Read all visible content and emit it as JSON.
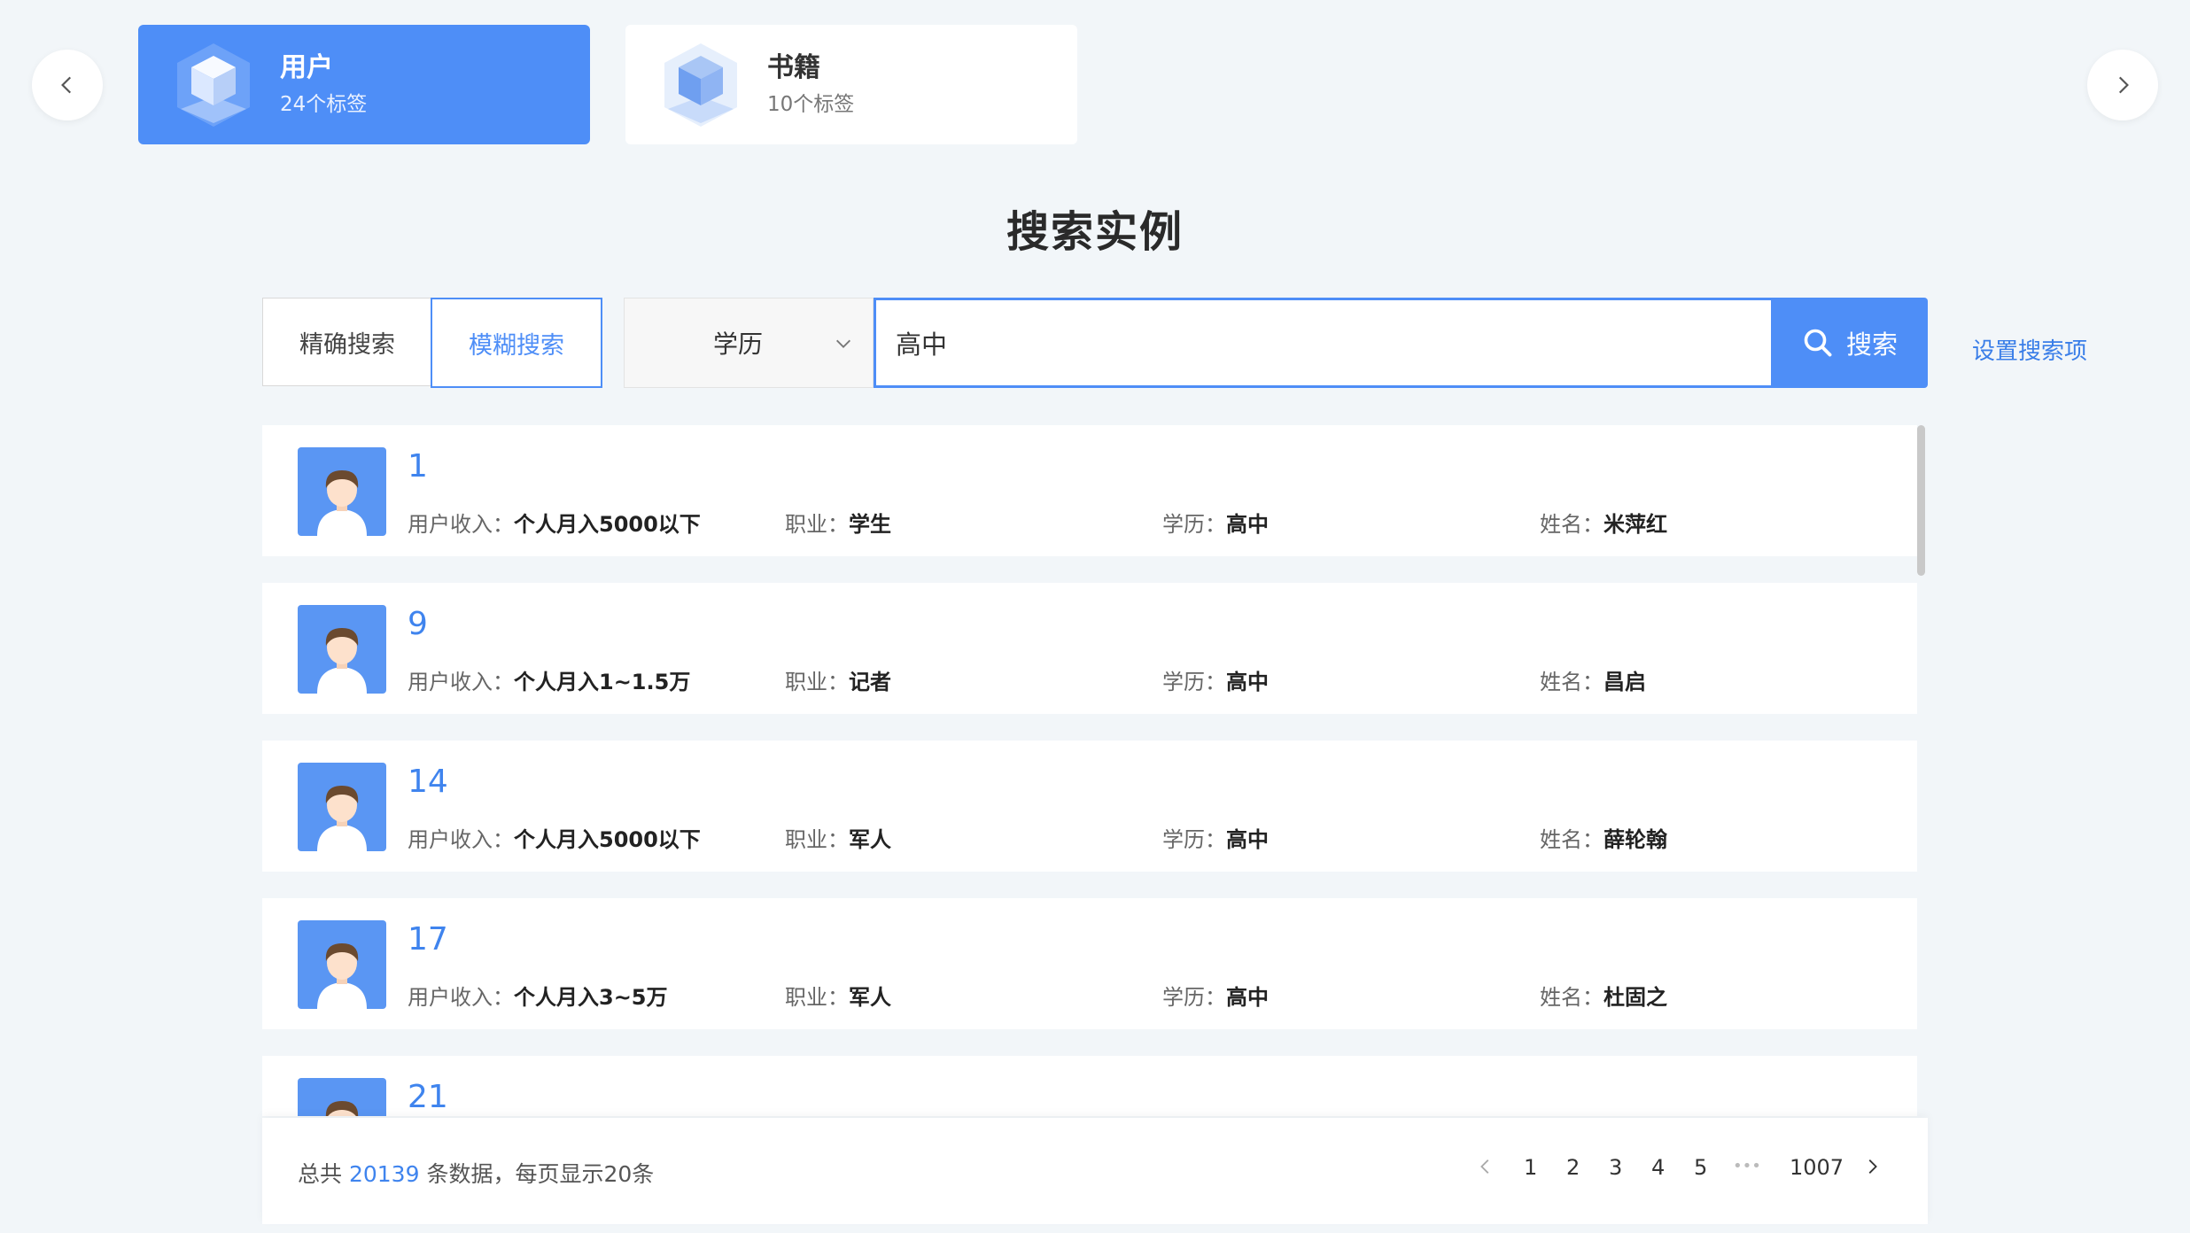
{
  "nav": {
    "prev_icon": "chevron-left-icon",
    "next_icon": "chevron-right-icon"
  },
  "cards": [
    {
      "title": "用户",
      "subtitle": "24个标签",
      "active": true,
      "icon": "cube-icon"
    },
    {
      "title": "书籍",
      "subtitle": "10个标签",
      "active": false,
      "icon": "cube-icon"
    }
  ],
  "page_title": "搜索实例",
  "search": {
    "mode_exact": "精确搜索",
    "mode_fuzzy": "模糊搜索",
    "active_mode": "模糊搜索",
    "field_selected": "学历",
    "query_value": "高中",
    "button_label": "搜索",
    "config_link": "设置搜索项"
  },
  "field_labels": {
    "income": "用户收入：",
    "job": "职业：",
    "education": "学历：",
    "name": "姓名："
  },
  "results": [
    {
      "id": "1",
      "income": "个人月入5000以下",
      "job": "学生",
      "education": "高中",
      "name": "米萍红"
    },
    {
      "id": "9",
      "income": "个人月入1~1.5万",
      "job": "记者",
      "education": "高中",
      "name": "昌启"
    },
    {
      "id": "14",
      "income": "个人月入5000以下",
      "job": "军人",
      "education": "高中",
      "name": "薛轮翰"
    },
    {
      "id": "17",
      "income": "个人月入3~5万",
      "job": "军人",
      "education": "高中",
      "name": "杜固之"
    },
    {
      "id": "21",
      "income": "",
      "job": "",
      "education": "",
      "name": ""
    }
  ],
  "footer": {
    "summary_prefix": "总共",
    "total": "20139",
    "summary_suffix": "条数据，每页显示20条",
    "pages": [
      "1",
      "2",
      "3",
      "4",
      "5"
    ],
    "ellipsis": "•••",
    "last_page": "1007"
  },
  "colors": {
    "accent": "#4e8ef7",
    "background": "#f2f6f9",
    "link": "#3a7ee8"
  }
}
